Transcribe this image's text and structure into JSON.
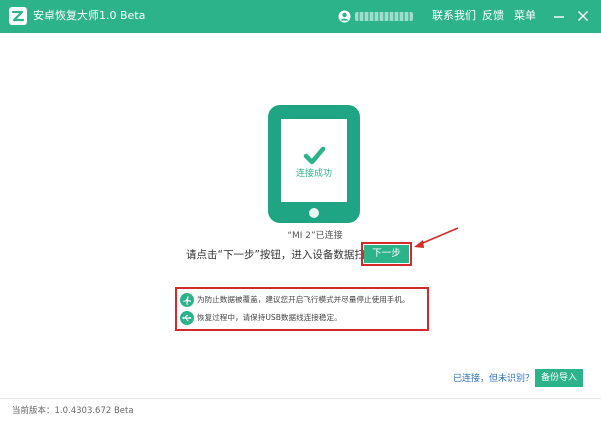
{
  "window": {
    "title": "安卓恢复大师1.0 Beta",
    "menu": [
      "联系我们",
      "反馈",
      "菜单"
    ]
  },
  "colors": {
    "brand": "#2db38a",
    "highlight": "#d42a2a",
    "link": "#2b6fc2"
  },
  "icons": [
    "app-logo-icon",
    "user-icon",
    "minimize-icon",
    "close-icon",
    "phone-icon",
    "checkmark-icon",
    "airplane-icon",
    "usb-icon"
  ],
  "main": {
    "phone_status": "连接成功",
    "device_connected": "“MI 2”已连接",
    "prompt": "请点击“下一步”按钮，进入设备数据扫描",
    "next_button": "下一步",
    "tips": [
      "为防止数据被覆盖，建议您开启飞行模式并尽量停止使用手机。",
      "恢复过程中，请保持USB数据线连接稳定。"
    ]
  },
  "bottom": {
    "not_recognized": "已连接，但未识别？",
    "backup_import": "备份导入"
  },
  "status": {
    "version": "当前版本：1.0.4303.672 Beta"
  }
}
